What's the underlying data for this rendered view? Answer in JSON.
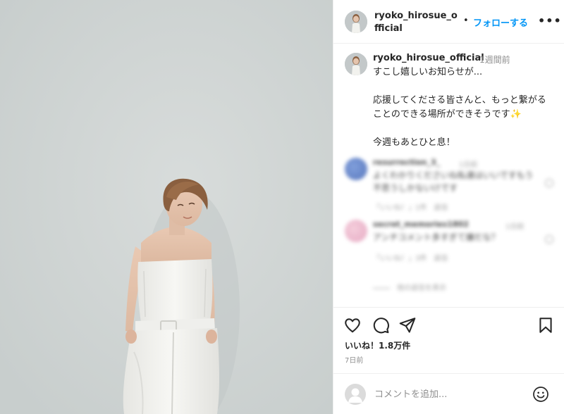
{
  "header": {
    "username": "ryoko_hirosue_official",
    "separator": "•",
    "follow_label": "フォローする",
    "more_label": "•••"
  },
  "caption": {
    "username": "ryoko_hirosue_official",
    "time": "1週間前",
    "lines": [
      "すこし嬉しいお知らせが...",
      "応援してくださる皆さんと、もっと繋がることのできる場所ができそうです",
      "今週もあとひと息！"
    ],
    "sparkle": "✨"
  },
  "comments": [
    {
      "username": "resurrection_3_",
      "time": "1日前",
      "text": "よくわかりくださいね私達はいいですもう不思うしかないけです",
      "meta": "「いいね！」1件　返信"
    },
    {
      "username": "secret_memories1802",
      "time": "1日前",
      "text": "アンチコメント多すぎて嫌だな？",
      "meta": "「いいね！」3件　返信"
    }
  ],
  "replies_label": "他の返信を表示",
  "actions": {
    "likes": "いいね！1.8万件",
    "posted": "7日前"
  },
  "add_comment": {
    "placeholder": "コメントを追加..."
  },
  "colors": {
    "accent": "#0095f6",
    "text": "#262626",
    "muted": "#8e8e8e"
  }
}
